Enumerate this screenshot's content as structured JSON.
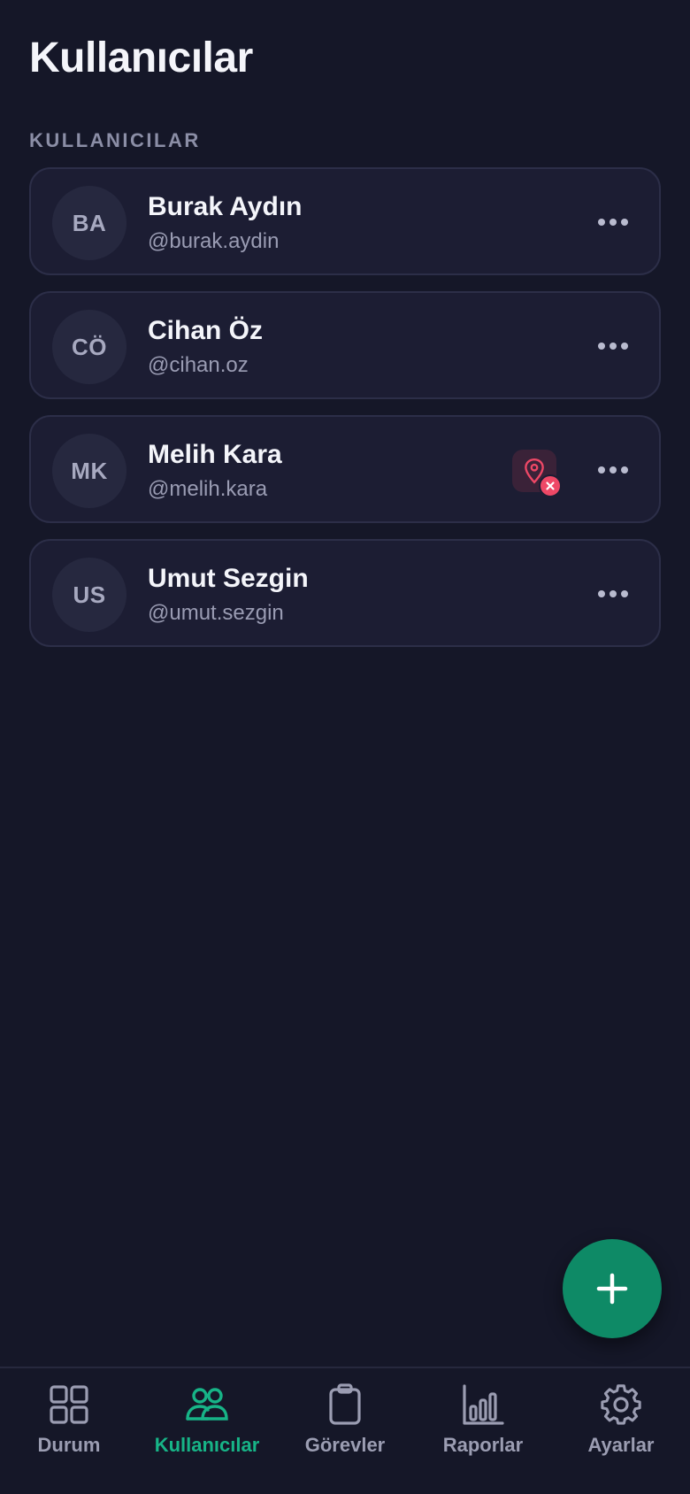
{
  "header": {
    "title": "Kullanıcılar"
  },
  "section": {
    "label": "KULLANICILAR"
  },
  "users": [
    {
      "initials": "BA",
      "name": "Burak Aydın",
      "handle": "@burak.aydin",
      "location_off": false
    },
    {
      "initials": "CÖ",
      "name": "Cihan Öz",
      "handle": "@cihan.oz",
      "location_off": false
    },
    {
      "initials": "MK",
      "name": "Melih Kara",
      "handle": "@melih.kara",
      "location_off": true
    },
    {
      "initials": "US",
      "name": "Umut Sezgin",
      "handle": "@umut.sezgin",
      "location_off": false
    }
  ],
  "fab": {
    "icon": "plus-icon"
  },
  "nav": {
    "active": "kullanicilar",
    "items": [
      {
        "id": "durum",
        "label": "Durum",
        "icon": "grid-icon"
      },
      {
        "id": "kullanicilar",
        "label": "Kullanıcılar",
        "icon": "users-icon"
      },
      {
        "id": "gorevler",
        "label": "Görevler",
        "icon": "clipboard-icon"
      },
      {
        "id": "raporlar",
        "label": "Raporlar",
        "icon": "bar-chart-icon"
      },
      {
        "id": "ayarlar",
        "label": "Ayarlar",
        "icon": "gear-icon"
      }
    ]
  },
  "colors": {
    "background": "#151728",
    "card": "#1c1d33",
    "accent": "#17b487",
    "fab": "#0e8a66",
    "alert": "#ee4866"
  }
}
